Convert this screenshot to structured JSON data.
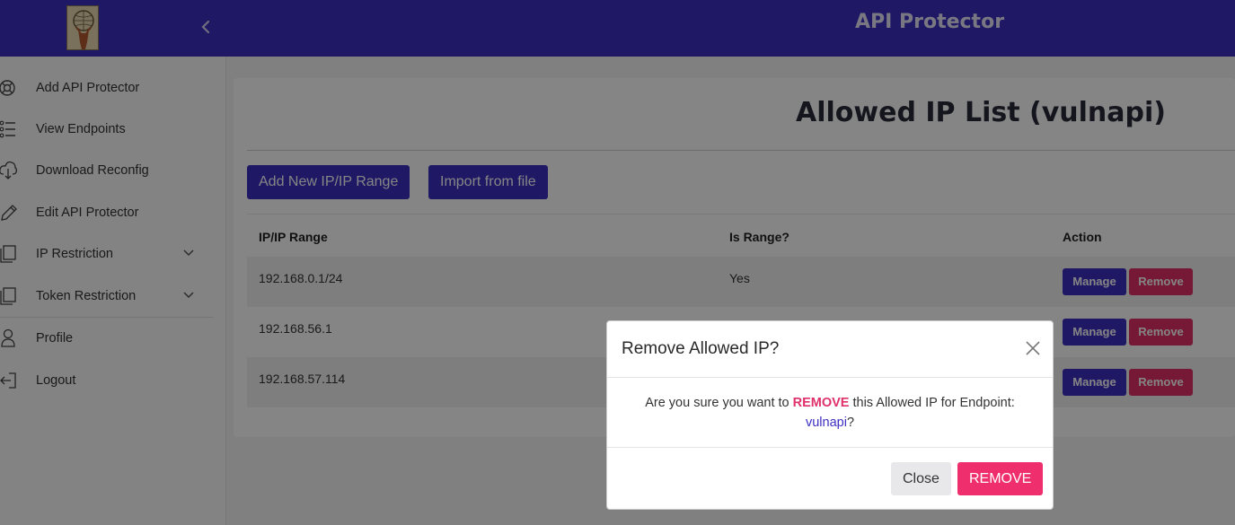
{
  "header": {
    "title": "API Protector"
  },
  "sidebar": {
    "items": [
      {
        "label": "Add API Protector",
        "icon": "lifebuoy-icon"
      },
      {
        "label": "View Endpoints",
        "icon": "list-icon"
      },
      {
        "label": "Download Reconfig",
        "icon": "cloud-download-icon"
      },
      {
        "label": "Edit API Protector",
        "icon": "pencil-icon"
      },
      {
        "label": "IP Restriction",
        "icon": "copy-icon"
      },
      {
        "label": "Token Restriction",
        "icon": "copy-icon"
      },
      {
        "label": "Profile",
        "icon": "person-icon"
      },
      {
        "label": "Logout",
        "icon": "logout-icon"
      }
    ]
  },
  "main": {
    "title": "Allowed IP List (vulnapi)",
    "add_button": "Add New IP/IP Range",
    "import_button": "Import from file",
    "table": {
      "headers": [
        "IP/IP Range",
        "Is Range?",
        "Action"
      ],
      "rows": [
        {
          "ip": "192.168.0.1/24",
          "is_range": "Yes"
        },
        {
          "ip": "192.168.56.1",
          "is_range": ""
        },
        {
          "ip": "192.168.57.114",
          "is_range": ""
        }
      ],
      "manage_label": "Manage",
      "remove_label": "Remove"
    }
  },
  "modal": {
    "title": "Remove Allowed IP?",
    "body_prefix": "Are you sure you want to ",
    "body_emphasis": "REMOVE",
    "body_suffix": " this Allowed IP for Endpoint:",
    "endpoint": "vulnapi",
    "body_end": "?",
    "close_label": "Close",
    "confirm_label": "REMOVE"
  },
  "colors": {
    "brand": "#3c2fc2",
    "danger": "#e0306a"
  }
}
